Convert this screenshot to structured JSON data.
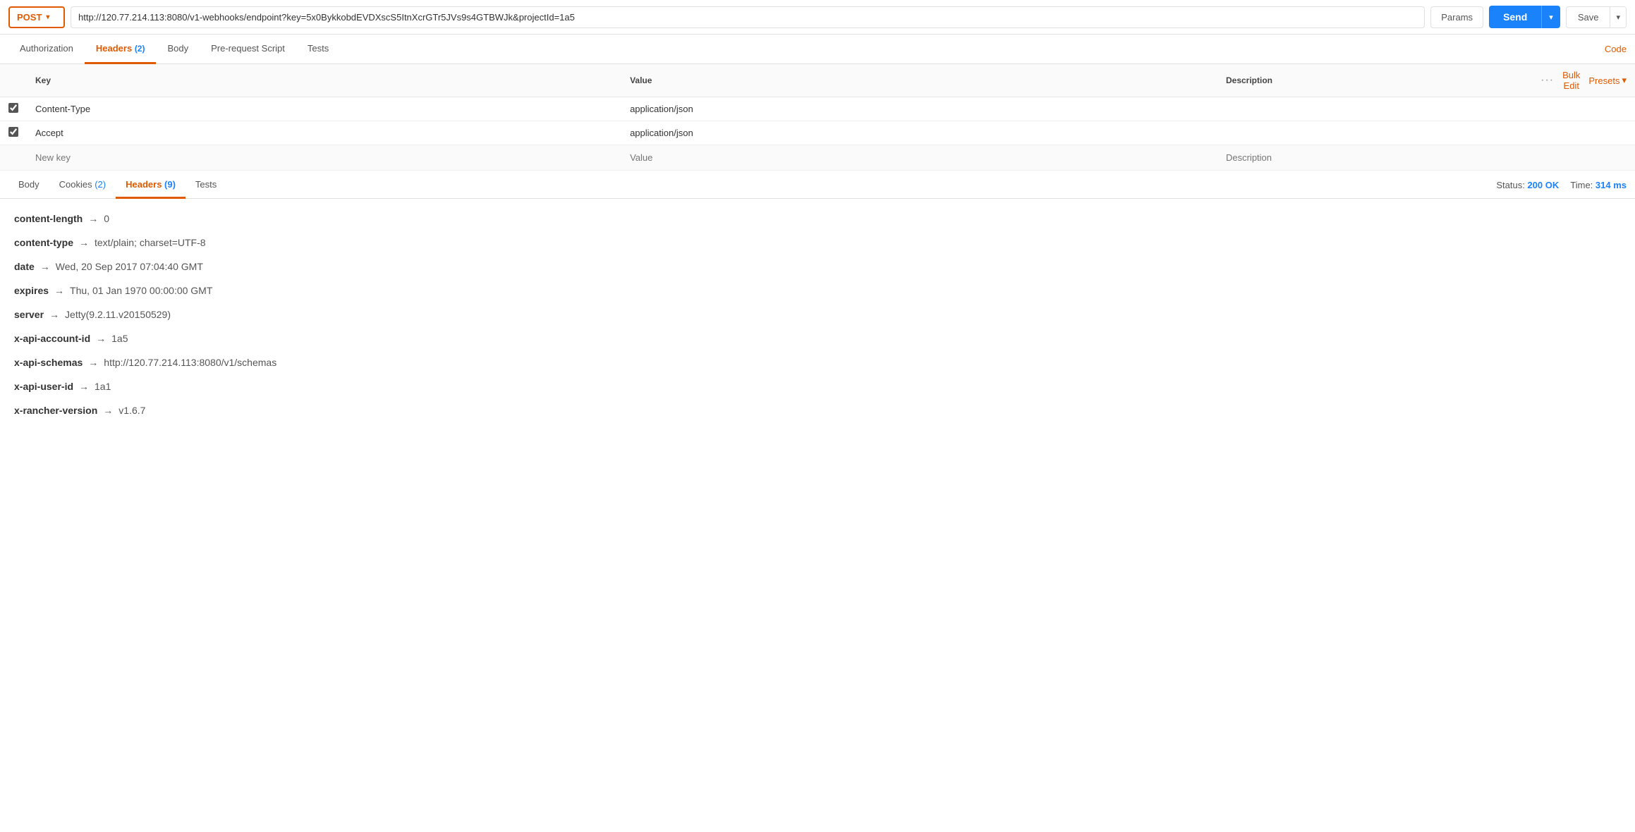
{
  "topbar": {
    "method": "POST",
    "url": "http://120.77.214.113:8080/v1-webhooks/endpoint?key=5x0BykkobdEVDXscS5ItnXcrGTr5JVs9s4GTBWJk&projectId=1a5",
    "params_label": "Params",
    "send_label": "Send",
    "save_label": "Save"
  },
  "request_tabs": [
    {
      "label": "Authorization",
      "active": false,
      "badge": null
    },
    {
      "label": "Headers",
      "active": true,
      "badge": "2"
    },
    {
      "label": "Body",
      "active": false,
      "badge": null
    },
    {
      "label": "Pre-request Script",
      "active": false,
      "badge": null
    },
    {
      "label": "Tests",
      "active": false,
      "badge": null
    }
  ],
  "code_link": "Code",
  "headers_table": {
    "columns": [
      "",
      "Key",
      "Value",
      "Description"
    ],
    "rows": [
      {
        "checked": true,
        "key": "Content-Type",
        "value": "application/json",
        "description": ""
      },
      {
        "checked": true,
        "key": "Accept",
        "value": "application/json",
        "description": ""
      }
    ],
    "new_row": {
      "key_placeholder": "New key",
      "value_placeholder": "Value",
      "desc_placeholder": "Description"
    },
    "bulk_edit_label": "Bulk Edit",
    "presets_label": "Presets"
  },
  "response_tabs": [
    {
      "label": "Body",
      "active": false,
      "badge": null
    },
    {
      "label": "Cookies",
      "active": false,
      "badge": "2"
    },
    {
      "label": "Headers",
      "active": true,
      "badge": "9"
    },
    {
      "label": "Tests",
      "active": false,
      "badge": null
    }
  ],
  "status": {
    "label": "Status:",
    "value": "200 OK",
    "time_label": "Time:",
    "time_value": "314 ms"
  },
  "response_headers": [
    {
      "key": "content-length",
      "value": "0"
    },
    {
      "key": "content-type",
      "value": "text/plain; charset=UTF-8"
    },
    {
      "key": "date",
      "value": "Wed, 20 Sep 2017 07:04:40 GMT"
    },
    {
      "key": "expires",
      "value": "Thu, 01 Jan 1970 00:00:00 GMT"
    },
    {
      "key": "server",
      "value": "Jetty(9.2.11.v20150529)"
    },
    {
      "key": "x-api-account-id",
      "value": "1a5"
    },
    {
      "key": "x-api-schemas",
      "value": "http://120.77.214.113:8080/v1/schemas"
    },
    {
      "key": "x-api-user-id",
      "value": "1a1"
    },
    {
      "key": "x-rancher-version",
      "value": "v1.6.7"
    }
  ],
  "colors": {
    "accent": "#e05a00",
    "blue": "#1a82fb",
    "border": "#e0e0e0"
  }
}
